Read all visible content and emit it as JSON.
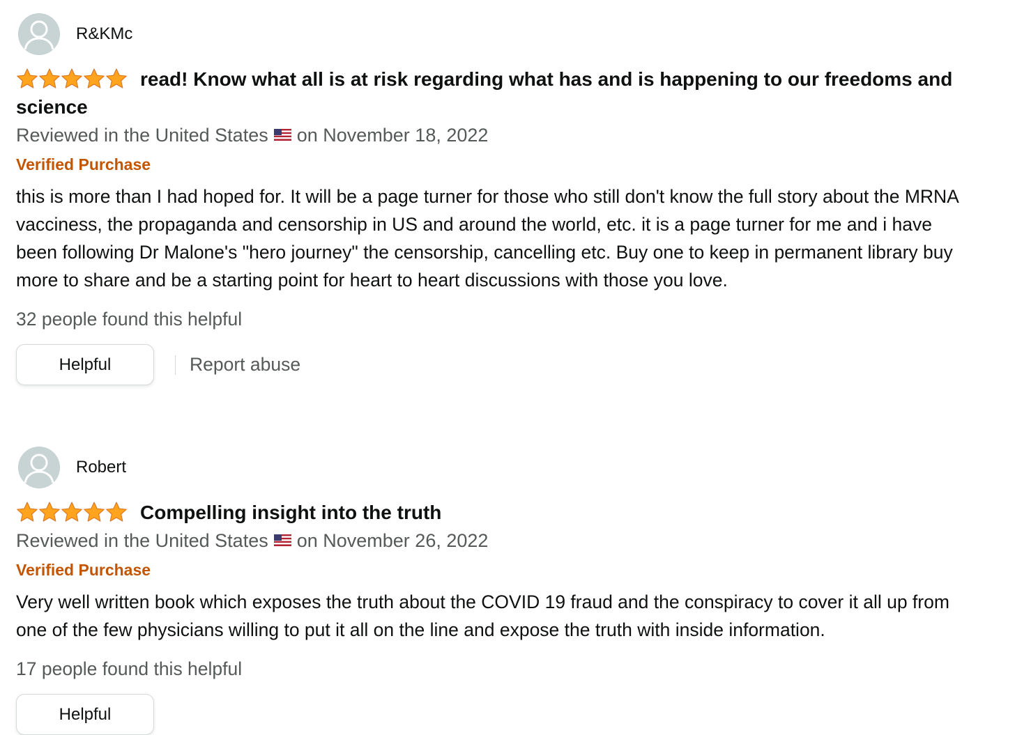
{
  "reviews": [
    {
      "author": "R&KMc",
      "rating": 5,
      "title": "read! Know what all is at risk regarding what has and is happening to our freedoms and science",
      "reviewed_prefix": "Reviewed in the United States",
      "reviewed_suffix": "on November 18, 2022",
      "verified": "Verified Purchase",
      "body": "this is more than I had hoped for. It will be a page turner for those who still don't know the full story about the MRNA vacciness, the propaganda and censorship in US and around the world, etc. it is a page turner for me and i have been following Dr Malone's \"hero journey\" the censorship, cancelling etc. Buy one to keep in permanent library buy more to share and be a starting point for heart to heart discussions with those you love.",
      "helpful_count": "32 people found this helpful",
      "helpful_button": "Helpful",
      "report": "Report abuse"
    },
    {
      "author": "Robert",
      "rating": 5,
      "title": "Compelling insight into the truth",
      "reviewed_prefix": "Reviewed in the United States",
      "reviewed_suffix": "on November 26, 2022",
      "verified": "Verified Purchase",
      "body": "Very well written book which exposes the truth about the COVID 19 fraud and the conspiracy to cover it all up from one of the few physicians willing to put it all on the line and expose the truth with inside information.",
      "helpful_count": "17 people found this helpful",
      "helpful_button": "Helpful"
    }
  ],
  "icons": {
    "avatar": "default-user-avatar-icon",
    "star": "star-filled-icon",
    "flag": "us-flag-icon"
  },
  "colors": {
    "star": "#ffa41c",
    "verified": "#c45500",
    "secondary_text": "#565959",
    "primary_text": "#0f1111",
    "avatar_bg": "#c8d3d4"
  }
}
